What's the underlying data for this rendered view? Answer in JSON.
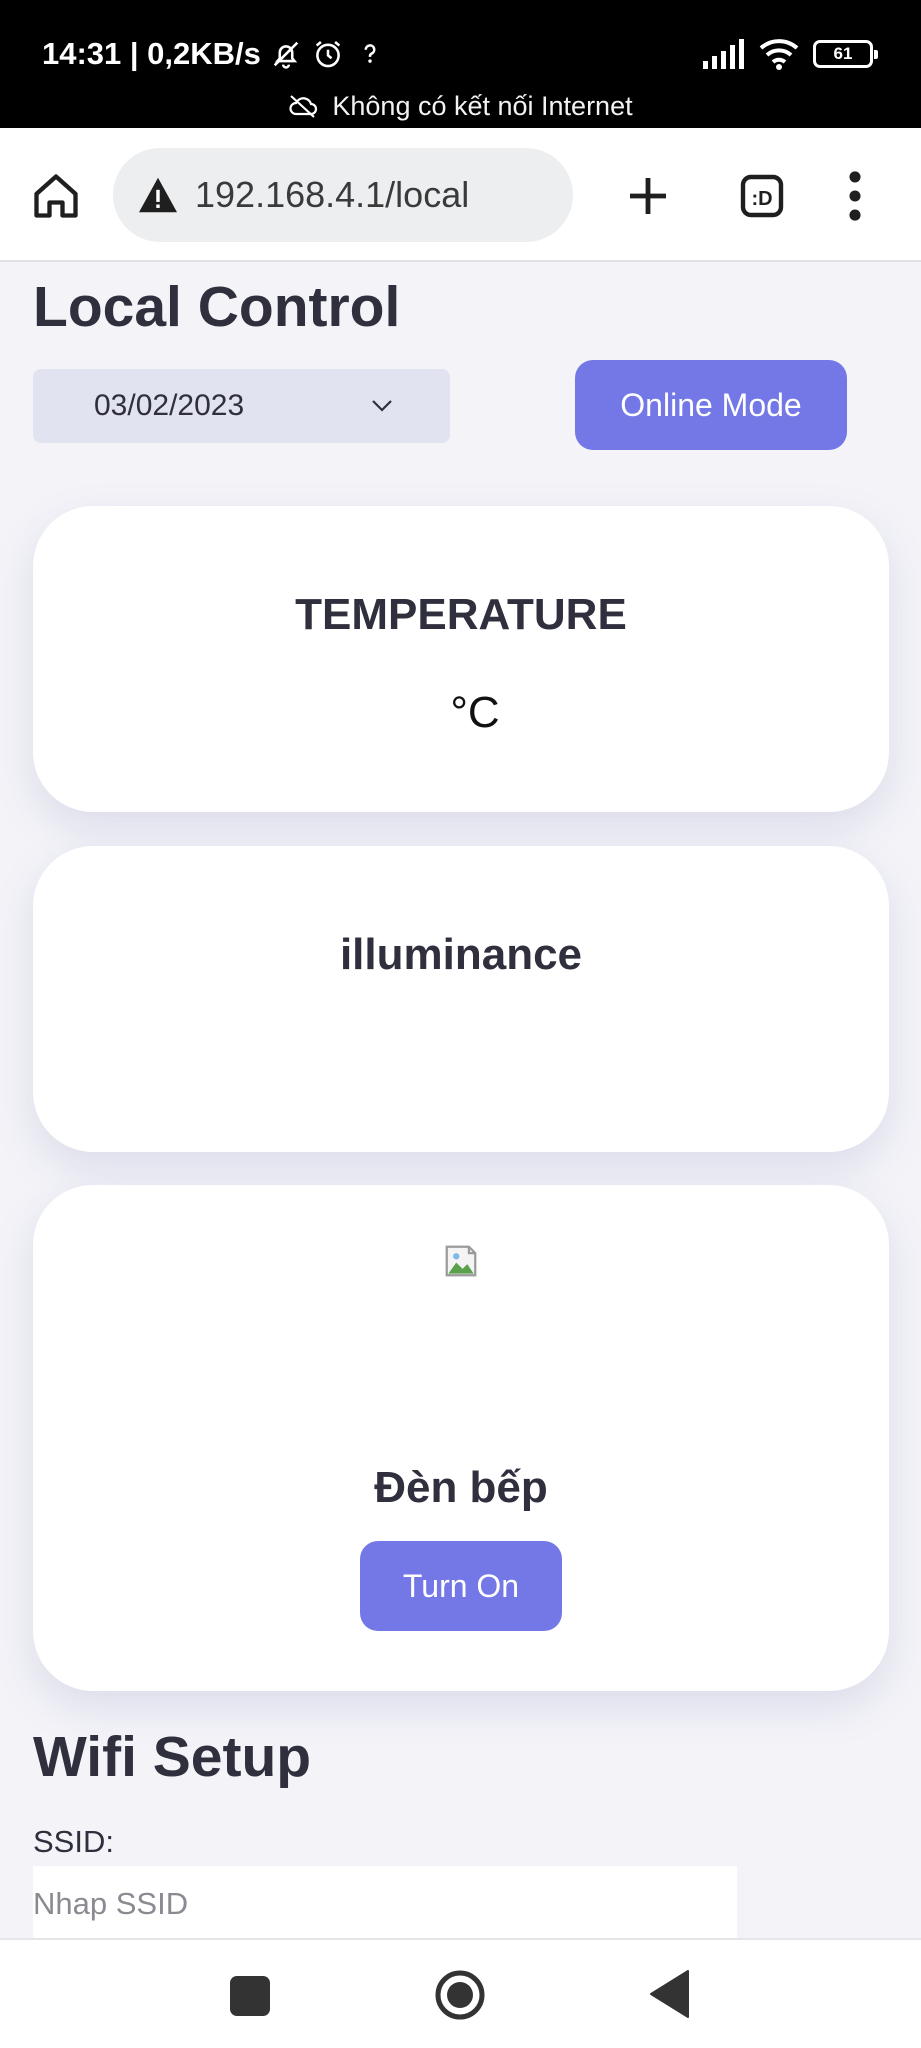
{
  "status_bar": {
    "time_speed": "14:31 | 0,2KB/s",
    "battery": "61",
    "connection_notice": "Không có kết nối Internet",
    "icons": [
      "mute-icon",
      "alarm-icon",
      "unknown-network-icon",
      "signal-icon",
      "wifi-icon",
      "battery-icon"
    ]
  },
  "browser": {
    "url": "192.168.4.1/local",
    "tab_switcher_label": ":D",
    "icons": [
      "home-icon",
      "warning-icon",
      "plus-icon",
      "tabs-icon",
      "menu-icon"
    ]
  },
  "page": {
    "title": "Local Control",
    "date_select": {
      "value": "03/02/2023"
    },
    "online_button": "Online Mode",
    "cards": {
      "temperature": {
        "title": "TEMPERATURE",
        "unit": "°C"
      },
      "illuminance": {
        "title": "illuminance"
      },
      "lamp": {
        "title": "Đèn bếp",
        "button": "Turn On"
      }
    },
    "wifi": {
      "title": "Wifi Setup",
      "ssid_label": "SSID:",
      "ssid_placeholder": "Nhap SSID",
      "ssid_value": ""
    }
  },
  "colors": {
    "accent": "#7378e6",
    "page_bg": "#f3f3f8",
    "text": "#2f2f3e",
    "select_bg": "#e2e3f1"
  }
}
